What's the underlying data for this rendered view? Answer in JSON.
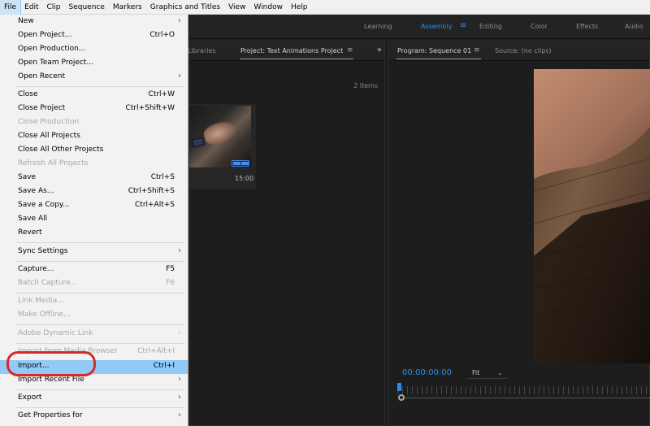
{
  "menubar": {
    "items": [
      "File",
      "Edit",
      "Clip",
      "Sequence",
      "Markers",
      "Graphics and Titles",
      "View",
      "Window",
      "Help"
    ]
  },
  "file_menu": {
    "items": [
      {
        "label": "New",
        "shortcut": "",
        "submenu": true,
        "disabled": false
      },
      {
        "label": "Open Project...",
        "shortcut": "Ctrl+O",
        "submenu": false,
        "disabled": false
      },
      {
        "label": "Open Production...",
        "shortcut": "",
        "submenu": false,
        "disabled": false
      },
      {
        "label": "Open Team Project...",
        "shortcut": "",
        "submenu": false,
        "disabled": false
      },
      {
        "label": "Open Recent",
        "shortcut": "",
        "submenu": true,
        "disabled": false
      },
      {
        "label": "Close",
        "shortcut": "Ctrl+W",
        "submenu": false,
        "disabled": false
      },
      {
        "label": "Close Project",
        "shortcut": "Ctrl+Shift+W",
        "submenu": false,
        "disabled": false
      },
      {
        "label": "Close Production",
        "shortcut": "",
        "submenu": false,
        "disabled": true
      },
      {
        "label": "Close All Projects",
        "shortcut": "",
        "submenu": false,
        "disabled": false
      },
      {
        "label": "Close All Other Projects",
        "shortcut": "",
        "submenu": false,
        "disabled": false
      },
      {
        "label": "Refresh All Projects",
        "shortcut": "",
        "submenu": false,
        "disabled": true
      },
      {
        "label": "Save",
        "shortcut": "Ctrl+S",
        "submenu": false,
        "disabled": false
      },
      {
        "label": "Save As...",
        "shortcut": "Ctrl+Shift+S",
        "submenu": false,
        "disabled": false
      },
      {
        "label": "Save a Copy...",
        "shortcut": "Ctrl+Alt+S",
        "submenu": false,
        "disabled": false
      },
      {
        "label": "Save All",
        "shortcut": "",
        "submenu": false,
        "disabled": false
      },
      {
        "label": "Revert",
        "shortcut": "",
        "submenu": false,
        "disabled": false
      },
      {
        "label": "Sync Settings",
        "shortcut": "",
        "submenu": true,
        "disabled": false
      },
      {
        "label": "Capture...",
        "shortcut": "F5",
        "submenu": false,
        "disabled": false
      },
      {
        "label": "Batch Capture...",
        "shortcut": "F6",
        "submenu": false,
        "disabled": true
      },
      {
        "label": "Link Media...",
        "shortcut": "",
        "submenu": false,
        "disabled": true
      },
      {
        "label": "Make Offline...",
        "shortcut": "",
        "submenu": false,
        "disabled": true
      },
      {
        "label": "Adobe Dynamic Link",
        "shortcut": "",
        "submenu": true,
        "disabled": true
      },
      {
        "label": "Import from Media Browser",
        "shortcut": "Ctrl+Alt+I",
        "submenu": false,
        "disabled": true
      },
      {
        "label": "Import...",
        "shortcut": "Ctrl+I",
        "submenu": false,
        "disabled": false,
        "highlighted": true
      },
      {
        "label": "Import Recent File",
        "shortcut": "",
        "submenu": true,
        "disabled": false
      },
      {
        "label": "Export",
        "shortcut": "",
        "submenu": true,
        "disabled": false
      },
      {
        "label": "Get Properties for",
        "shortcut": "",
        "submenu": true,
        "disabled": false
      }
    ]
  },
  "workspaces": {
    "items": [
      "Learning",
      "Assembly",
      "Editing",
      "Color",
      "Effects",
      "Audio"
    ],
    "active": "Assembly"
  },
  "project_panel": {
    "libraries_tab": "Libraries",
    "project_tab": "Project: Text Animations Project",
    "items_count": "2 items",
    "clip_duration": "15:00"
  },
  "program_panel": {
    "program_tab": "Program: Sequence 01",
    "source_tab": "Source: (no clips)",
    "timecode": "00:00:00:00",
    "fit": "Fit"
  },
  "colors": {
    "accent": "#2d8ceb",
    "highlight": "#91c9f7",
    "annotation": "#d42a2a"
  }
}
